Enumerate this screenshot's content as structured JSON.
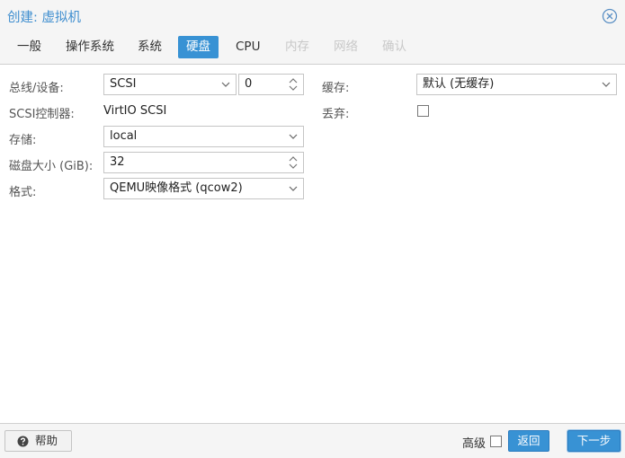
{
  "window": {
    "title": "创建: 虚拟机"
  },
  "tabs": [
    {
      "label": "一般",
      "state": "normal"
    },
    {
      "label": "操作系统",
      "state": "normal"
    },
    {
      "label": "系统",
      "state": "normal"
    },
    {
      "label": "硬盘",
      "state": "active"
    },
    {
      "label": "CPU",
      "state": "normal"
    },
    {
      "label": "内存",
      "state": "disabled"
    },
    {
      "label": "网络",
      "state": "disabled"
    },
    {
      "label": "确认",
      "state": "disabled"
    }
  ],
  "form": {
    "bus": {
      "label": "总线/设备:",
      "bus_value": "SCSI",
      "device_value": "0"
    },
    "controller": {
      "label": "SCSI控制器:",
      "value": "VirtIO SCSI"
    },
    "storage": {
      "label": "存储:",
      "value": "local"
    },
    "disk_size": {
      "label": "磁盘大小 (GiB):",
      "value": "32"
    },
    "format": {
      "label": "格式:",
      "value": "QEMU映像格式 (qcow2)"
    },
    "cache": {
      "label": "缓存:",
      "value": "默认 (无缓存)"
    },
    "discard": {
      "label": "丢弃:",
      "checked": false
    }
  },
  "footer": {
    "help_label": "帮助",
    "advanced_label": "高级",
    "advanced_checked": false,
    "back_label": "返回",
    "next_label": "下一步"
  },
  "colors": {
    "accent": "#3892d4",
    "title": "#3f8ecf",
    "bar_bg": "#f5f5f5"
  }
}
